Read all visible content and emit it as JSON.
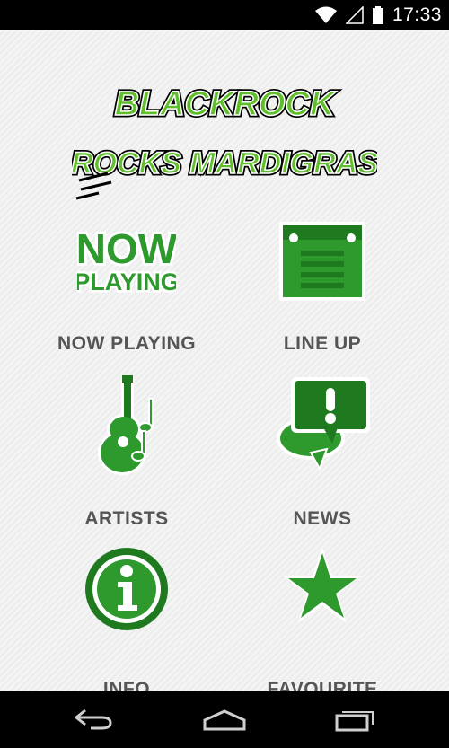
{
  "status_bar": {
    "time": "17:33",
    "icons": [
      "wifi-icon",
      "signal-icon",
      "battery-icon"
    ]
  },
  "logo": {
    "name": "logo",
    "line1": "BLACKROCK",
    "line2": "ROCKS MARDIGRAS"
  },
  "menu": [
    {
      "id": "now-playing",
      "label": "NOW PLAYING",
      "icon": "now-playing-icon",
      "icon_text": [
        "NOW",
        "PLAYING"
      ]
    },
    {
      "id": "line-up",
      "label": "LINE UP",
      "icon": "line-up-icon"
    },
    {
      "id": "artists",
      "label": "ARTISTS",
      "icon": "guitar-icon"
    },
    {
      "id": "news",
      "label": "NEWS",
      "icon": "news-icon"
    },
    {
      "id": "info",
      "label": "INFO",
      "icon": "info-icon"
    },
    {
      "id": "favourite",
      "label": "FAVOURITE",
      "icon": "star-icon"
    }
  ],
  "nav_bar": {
    "buttons": [
      "back-icon",
      "home-icon",
      "recents-icon"
    ]
  },
  "colors": {
    "accent_green": "#2e9a2e",
    "dark_green": "#1f7a1f",
    "label_gray": "#555555"
  }
}
